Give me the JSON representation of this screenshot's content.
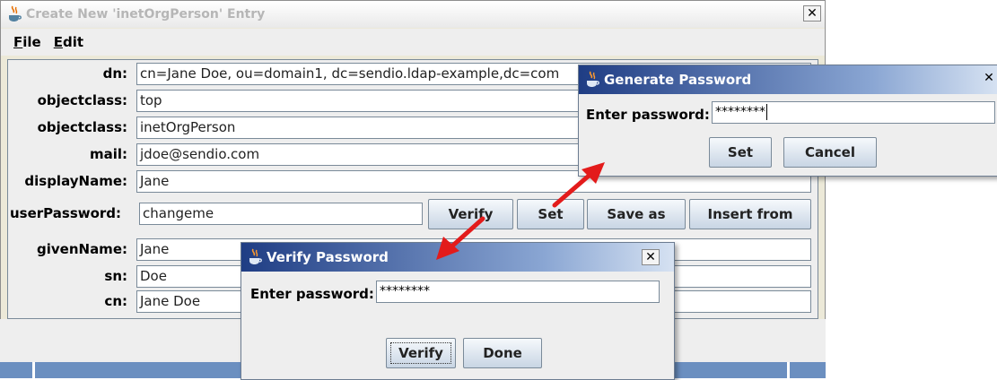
{
  "main_window": {
    "title": "Create New 'inetOrgPerson' Entry",
    "close_glyph": "✕",
    "menu": [
      {
        "u": "F",
        "rest": "ile"
      },
      {
        "u": "E",
        "rest": "dit"
      }
    ],
    "fields": {
      "dn": {
        "label": "dn:",
        "value": "cn=Jane Doe, ou=domain1, dc=sendio.ldap-example,dc=com"
      },
      "objectclass1": {
        "label": "objectclass:",
        "value": "top"
      },
      "objectclass2": {
        "label": "objectclass:",
        "value": "inetOrgPerson"
      },
      "mail": {
        "label": "mail:",
        "value": "jdoe@sendio.com"
      },
      "displayName": {
        "label": "displayName:",
        "value": "Jane"
      },
      "userPassword": {
        "label": "userPassword:",
        "value": "changeme"
      },
      "givenName": {
        "label": "givenName:",
        "value": "Jane"
      },
      "sn": {
        "label": "sn:",
        "value": "Doe"
      },
      "cn": {
        "label": "cn:",
        "value": "Jane Doe"
      }
    },
    "buttons": {
      "verify": "Verify",
      "set": "Set",
      "save_as": "Save as",
      "insert_from": "Insert from"
    }
  },
  "generate_dialog": {
    "title": "Generate Password",
    "close_glyph": "✕",
    "label": "Enter password:",
    "value": "********",
    "set": "Set",
    "cancel": "Cancel"
  },
  "verify_dialog": {
    "title": "Verify Password",
    "close_glyph": "✕",
    "label": "Enter password:",
    "value": "********",
    "verify": "Verify",
    "done": "Done"
  },
  "colors": {
    "arrow": "#e31b1b",
    "dialog_title_start": "#1f3d84",
    "window_bg": "#eeeeee"
  },
  "icons": {
    "app": "java-cup-icon",
    "close": "close-icon"
  }
}
